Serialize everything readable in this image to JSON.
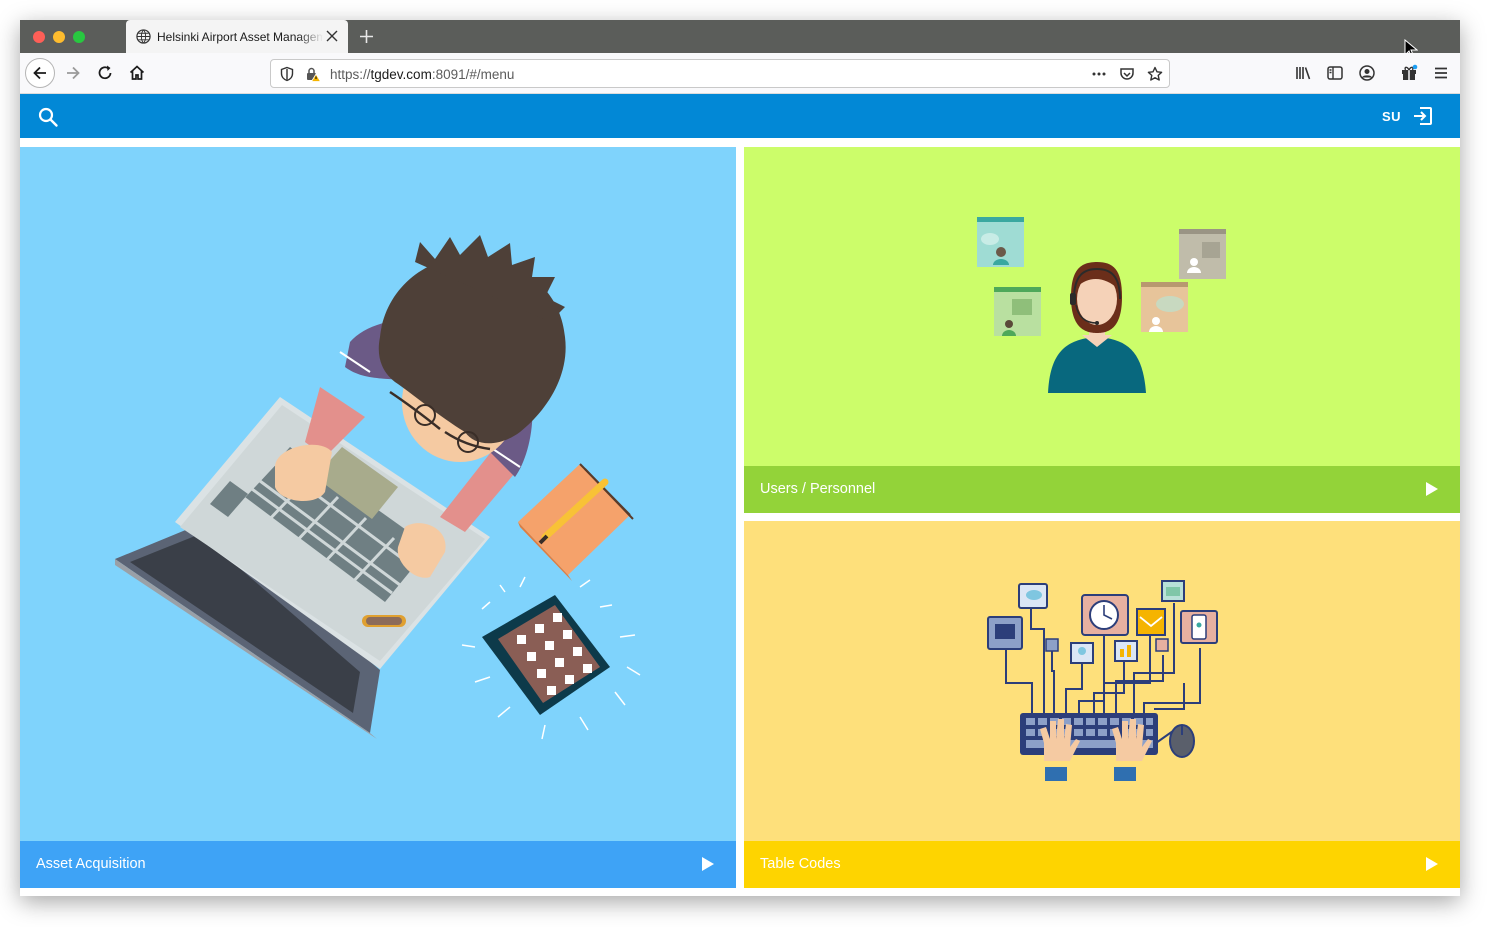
{
  "browser": {
    "tab_title": "Helsinki Airport Asset Management",
    "url_scheme": "https://",
    "url_host": "tgdev.com",
    "url_rest": ":8091/#/menu",
    "icons": [
      "back-icon",
      "forward-icon",
      "reload-icon",
      "home-icon",
      "shield-icon",
      "lock-warning-icon",
      "more-icon",
      "pocket-icon",
      "star-icon",
      "library-icon",
      "sidebar-icon",
      "account-icon",
      "extensions-icon",
      "menu-icon"
    ]
  },
  "app": {
    "user_initials": "SU",
    "colors": {
      "header": "#0288d6",
      "asset": "#7fd3fc",
      "users": "#ccfd6a",
      "codes": "#fee07b"
    }
  },
  "tiles": {
    "asset": {
      "label": "Asset Acquisition"
    },
    "users": {
      "label": "Users / Personnel"
    },
    "codes": {
      "label": "Table Codes"
    }
  }
}
